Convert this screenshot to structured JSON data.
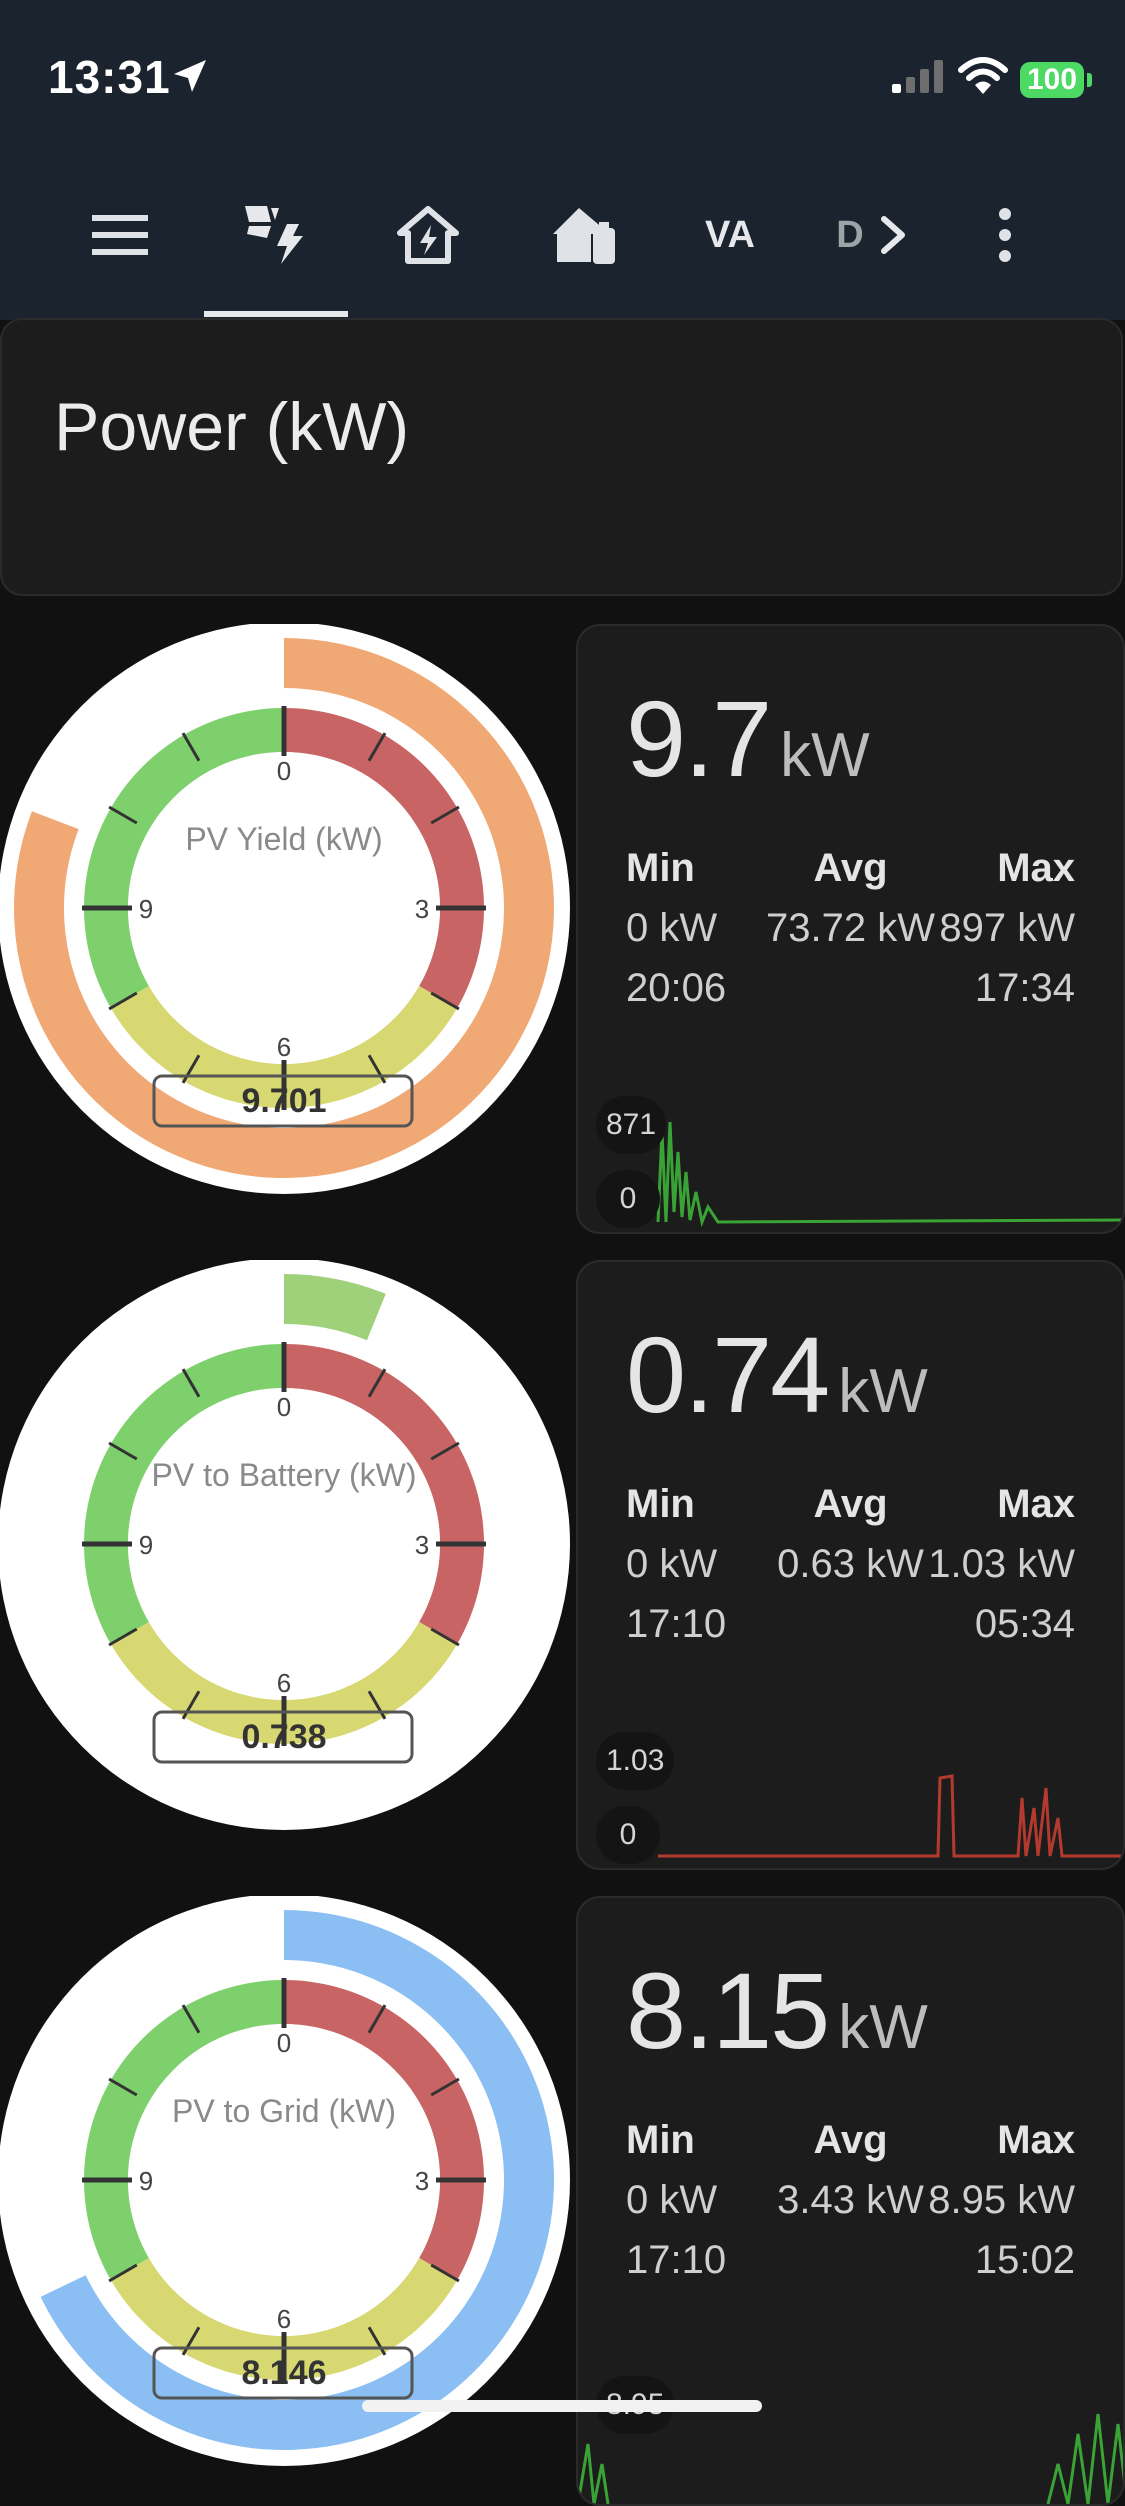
{
  "status_bar": {
    "time": "13:31",
    "battery": "100"
  },
  "toolbar": {
    "tabs": [
      {
        "name": "menu",
        "label": ""
      },
      {
        "name": "energy",
        "label": ""
      },
      {
        "name": "home",
        "label": ""
      },
      {
        "name": "battery-home",
        "label": ""
      },
      {
        "name": "va",
        "label": "VA"
      },
      {
        "name": "d",
        "label": "D"
      }
    ],
    "active_tab": 1
  },
  "header": {
    "title": "Power (kW)"
  },
  "panels": [
    {
      "gauge": {
        "title": "PV Yield (kW)",
        "value_text": "9.701",
        "value": 9.701,
        "max": 12,
        "ticks": [
          "0",
          "3",
          "6",
          "9"
        ],
        "band_color": "#f0a875"
      },
      "stats": {
        "value": "9.7",
        "unit": "kW",
        "min_label": "Min",
        "avg_label": "Avg",
        "max_label": "Max",
        "min": "0 kW",
        "avg": "73.72 kW",
        "max": "897 kW",
        "min_time": "20:06",
        "max_time": "17:34",
        "spark_max": "871",
        "spark_min": "0",
        "spark_color": "#3aa336"
      }
    },
    {
      "gauge": {
        "title": "PV to Battery (kW)",
        "value_text": "0.738",
        "value": 0.738,
        "max": 12,
        "ticks": [
          "0",
          "3",
          "6",
          "9"
        ],
        "band_color": "#9fd07a"
      },
      "stats": {
        "value": "0.74",
        "unit": "kW",
        "min_label": "Min",
        "avg_label": "Avg",
        "max_label": "Max",
        "min": "0 kW",
        "avg": "0.63 kW",
        "max": "1.03 kW",
        "min_time": "17:10",
        "max_time": "05:34",
        "spark_max": "1.03",
        "spark_min": "0",
        "spark_color": "#b33a2e"
      }
    },
    {
      "gauge": {
        "title": "PV to Grid (kW)",
        "value_text": "8.146",
        "value": 8.146,
        "max": 12,
        "ticks": [
          "0",
          "3",
          "6",
          "9"
        ],
        "band_color": "#8bbff3"
      },
      "stats": {
        "value": "8.15",
        "unit": "kW",
        "min_label": "Min",
        "avg_label": "Avg",
        "max_label": "Max",
        "min": "0 kW",
        "avg": "3.43 kW",
        "max": "8.95 kW",
        "min_time": "17:10",
        "max_time": "15:02",
        "spark_max": "8.95",
        "spark_min": "0",
        "spark_color": "#3aa336"
      }
    }
  ],
  "colors": {
    "gauge_green": "#7ed06c",
    "gauge_red": "#c86463",
    "gauge_yellow": "#d8d873",
    "background": "#111111",
    "card": "#1c1c1c"
  }
}
